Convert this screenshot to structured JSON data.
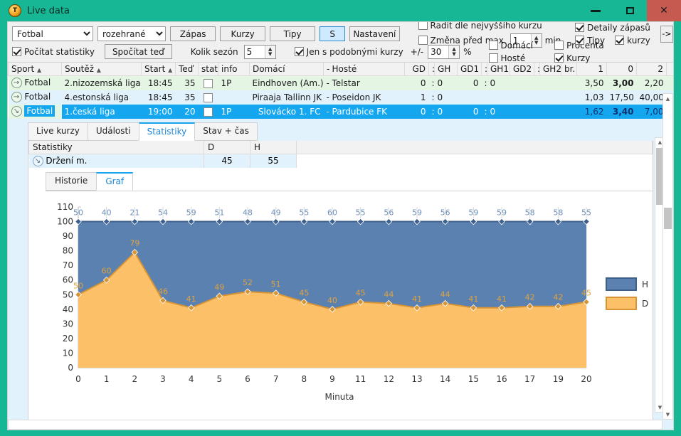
{
  "window": {
    "title": "Live data",
    "icon": "coin-icon",
    "minimize": "–",
    "maximize": "□",
    "close": "✕"
  },
  "toolbar": {
    "sport_select": {
      "value": "Fotbal",
      "options": [
        "Fotbal"
      ]
    },
    "state_select": {
      "value": "rozehrané",
      "options": [
        "rozehrané"
      ]
    },
    "buttons": [
      {
        "label": "Zápas",
        "selected": false
      },
      {
        "label": "Kurzy",
        "selected": false
      },
      {
        "label": "Tipy",
        "selected": false
      },
      {
        "label": "S",
        "selected": true
      },
      {
        "label": "Nastavení",
        "selected": false
      }
    ],
    "arrow_button": "->",
    "pocitat_statistiky": {
      "label": "Počítat statistiky",
      "checked": true
    },
    "spocitat_ted": {
      "label": "Spočítat teď"
    },
    "kolik_sezon": {
      "label": "Kolik sezón",
      "value": "5"
    },
    "jen_s_podobnymi": {
      "label": "Jen s podobnými kurzy",
      "checked": true
    },
    "plusminus_label": "+/-",
    "plusminus_value": "30",
    "percent_sign": "%",
    "radit_dle": {
      "label": "Řadit dle nejvyššího kurzu",
      "checked": false
    },
    "zmena_pred_max": {
      "label": "Změna před max.",
      "checked": false,
      "value": "1",
      "unit": "min."
    },
    "domaci": {
      "label": "Domácí",
      "checked": false
    },
    "hoste": {
      "label": "Hosté",
      "checked": false
    },
    "procenta": {
      "label": "Procenta",
      "checked": false
    },
    "kurzy_cb": {
      "label": "Kurzy",
      "checked": true
    },
    "detaily_zapasu": {
      "label": "Detaily zápasů",
      "checked": true
    },
    "tipy_cb": {
      "label": "Tipy",
      "checked": true
    },
    "kurzy_cb2": {
      "label": "kurzy",
      "checked": true
    }
  },
  "matches_table": {
    "columns": [
      "Sport",
      "Soutěž",
      "Start",
      "Teď",
      "stats",
      "info",
      "Domácí",
      "-",
      "Hosté",
      "GD",
      ":",
      "GH",
      "GD1",
      ":",
      "GH1",
      "GD2",
      ":",
      "GH2",
      "br.",
      "1",
      "0",
      "2"
    ],
    "rows": [
      {
        "icon": "arrow-right-circle-icon",
        "sport": "Fotbal",
        "league": "2.nizozemská liga",
        "start": "18:45",
        "now": "35",
        "info": "1P",
        "home": "Eindhoven (Am.)",
        "dash": "-",
        "away": "Telstar",
        "gd": "0",
        "colon1": ":",
        "gh": "0",
        "gd1": "0",
        "colon2": ":",
        "gh1": "0",
        "gd2": "",
        "colon3": "",
        "gh2": "",
        "br": "",
        "o1": "3,50",
        "o0": "3,00",
        "o2": "2,20",
        "o0_bold": true,
        "selected": false
      },
      {
        "icon": "arrow-right-circle-icon",
        "sport": "Fotbal",
        "league": "4.estonská liga",
        "start": "18:45",
        "now": "35",
        "info": "",
        "home": "Piraaja Tallinn JK",
        "dash": "-",
        "away": "Poseidon JK",
        "gd": "1",
        "colon1": ":",
        "gh": "0",
        "gd1": "",
        "colon2": "",
        "gh1": "",
        "gd2": "",
        "colon3": "",
        "gh2": "",
        "br": "",
        "o1": "1,03",
        "o0": "17,50",
        "o2": "40,00",
        "o0_bold": false,
        "selected": false
      },
      {
        "icon": "arrow-down-circle-icon",
        "sport": "Fotbal",
        "league": "1.česká liga",
        "start": "19:00",
        "now": "20",
        "info": "1P",
        "home": "Slovácko 1. FC",
        "dash": "-",
        "away": "Pardubice FK",
        "gd": "0",
        "colon1": ":",
        "gh": "0",
        "gd1": "0",
        "colon2": ":",
        "gh1": "0",
        "gd2": "",
        "colon3": "",
        "gh2": "",
        "br": "",
        "o1": "1,62",
        "o0": "3,40",
        "o2": "7,00",
        "o0_bold": true,
        "selected": true
      }
    ]
  },
  "detail": {
    "tabs": [
      {
        "label": "Live kurzy",
        "active": false
      },
      {
        "label": "Události",
        "active": false
      },
      {
        "label": "Statistiky",
        "active": true
      },
      {
        "label": "Stav + čas",
        "active": false
      }
    ],
    "stats_table": {
      "columns": [
        "Statistiky",
        "D",
        "H"
      ],
      "rows": [
        {
          "icon": "expand-circle-icon",
          "name": "Držení m.",
          "d": "45",
          "h": "55"
        }
      ]
    },
    "subtabs": [
      {
        "label": "Historie",
        "active": false
      },
      {
        "label": "Graf",
        "active": true
      }
    ]
  },
  "chart_data": {
    "type": "area",
    "title": "",
    "xlabel": "Minuta",
    "ylabel": "",
    "categories": [
      "0",
      "1",
      "2",
      "3",
      "4",
      "5",
      "6",
      "7",
      "8",
      "9",
      "11",
      "12",
      "13",
      "14",
      "15",
      "16",
      "17",
      "19",
      "20"
    ],
    "ylim": [
      0,
      110
    ],
    "yticks": [
      0,
      10,
      20,
      30,
      40,
      50,
      60,
      70,
      80,
      90,
      100,
      110
    ],
    "grid": true,
    "stacked": true,
    "legend_position": "right",
    "series": [
      {
        "name": "H",
        "color": "#5b81b0",
        "label_color": "#5b81b0",
        "values": [
          50,
          40,
          21,
          54,
          59,
          51,
          48,
          49,
          55,
          60,
          55,
          56,
          59,
          56,
          59,
          59,
          58,
          58,
          55
        ]
      },
      {
        "name": "D",
        "color": "#fcc069",
        "label_color": "#e0a23f",
        "values": [
          50,
          60,
          79,
          46,
          41,
          49,
          52,
          51,
          45,
          40,
          45,
          44,
          41,
          44,
          41,
          41,
          42,
          42,
          45
        ]
      }
    ]
  }
}
